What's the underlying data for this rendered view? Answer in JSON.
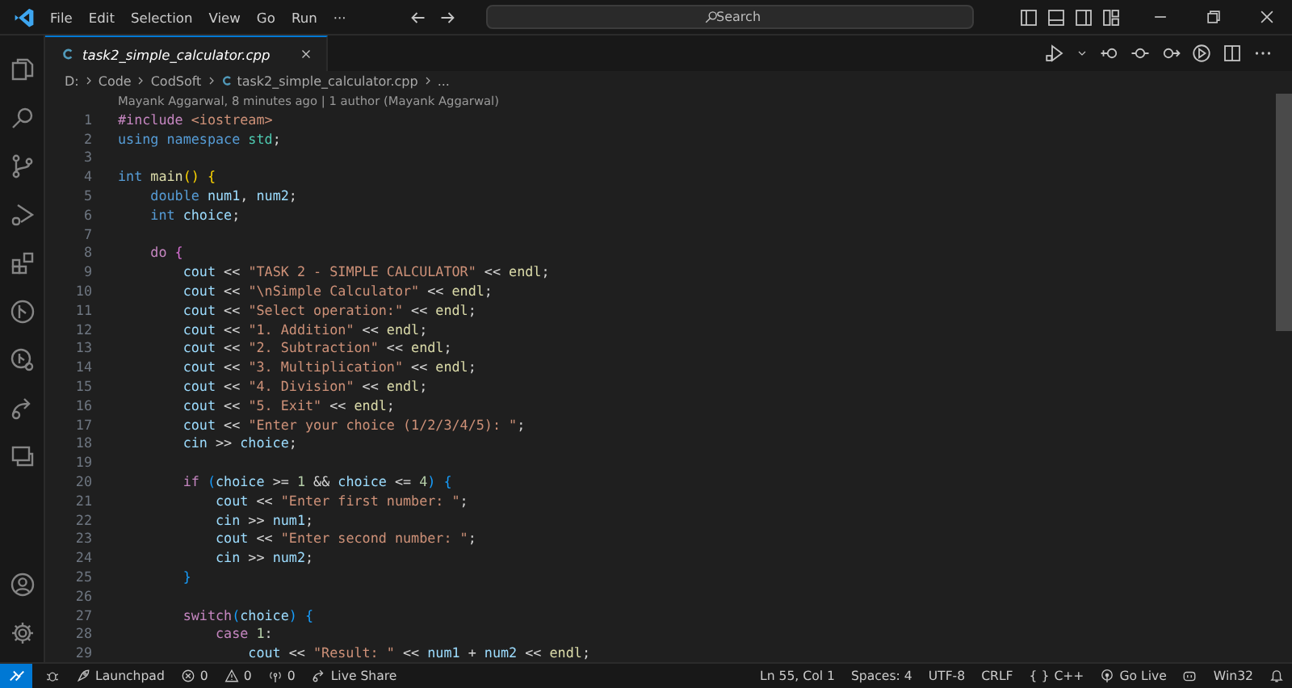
{
  "title_bar": {
    "menus": [
      "File",
      "Edit",
      "Selection",
      "View",
      "Go",
      "Run",
      "···"
    ],
    "search": {
      "placeholder": "Search"
    }
  },
  "tabs": [
    {
      "label": "task2_simple_calculator.cpp",
      "selected": true,
      "italic": true
    }
  ],
  "breadcrumb": [
    "D:",
    "Code",
    "CodSoft",
    "task2_simple_calculator.cpp",
    "..."
  ],
  "codelens": "Mayank Aggarwal, 8 minutes ago | 1 author (Mayank Aggarwal)",
  "code_lines": [
    {
      "number": "1",
      "tokens": [
        {
          "kind": "control",
          "text": "#include"
        },
        {
          "kind": "string",
          "text": " <iostream>"
        }
      ]
    },
    {
      "number": "2",
      "tokens": [
        {
          "kind": "keyword",
          "text": "using"
        },
        {
          "kind": "keyword",
          "text": " namespace"
        },
        {
          "kind": "type",
          "text": " std"
        },
        {
          "kind": "plain",
          "text": ";"
        }
      ]
    },
    {
      "number": "3"
    },
    {
      "number": "4",
      "tokens": [
        {
          "kind": "keyword",
          "text": "int"
        },
        {
          "kind": "function",
          "text": " main"
        },
        {
          "kind": "bracket1",
          "text": "()"
        },
        {
          "kind": "bracket1",
          "text": " {"
        }
      ]
    },
    {
      "number": "5",
      "tokens": [
        {
          "kind": "keyword",
          "text": "    double"
        },
        {
          "kind": "variable",
          "text": " num1"
        },
        {
          "kind": "plain",
          "text": ","
        },
        {
          "kind": "variable",
          "text": " num2"
        },
        {
          "kind": "plain",
          "text": ";"
        }
      ]
    },
    {
      "number": "6",
      "tokens": [
        {
          "kind": "keyword",
          "text": "    int"
        },
        {
          "kind": "variable",
          "text": " choice"
        },
        {
          "kind": "plain",
          "text": ";"
        }
      ]
    },
    {
      "number": "7"
    },
    {
      "number": "8",
      "tokens": [
        {
          "kind": "control",
          "text": "    do"
        },
        {
          "kind": "bracket2",
          "text": " {"
        }
      ]
    },
    {
      "number": "9",
      "tokens": [
        {
          "kind": "variable",
          "text": "        cout"
        },
        {
          "kind": "plain",
          "text": " << "
        },
        {
          "kind": "string",
          "text": "\"TASK 2 - SIMPLE CALCULATOR\""
        },
        {
          "kind": "plain",
          "text": " << "
        },
        {
          "kind": "function",
          "text": "endl"
        },
        {
          "kind": "plain",
          "text": ";"
        }
      ]
    },
    {
      "number": "10",
      "tokens": [
        {
          "kind": "variable",
          "text": "        cout"
        },
        {
          "kind": "plain",
          "text": " << "
        },
        {
          "kind": "string",
          "text": "\"\\nSimple Calculator\""
        },
        {
          "kind": "plain",
          "text": " << "
        },
        {
          "kind": "function",
          "text": "endl"
        },
        {
          "kind": "plain",
          "text": ";"
        }
      ]
    },
    {
      "number": "11",
      "tokens": [
        {
          "kind": "variable",
          "text": "        cout"
        },
        {
          "kind": "plain",
          "text": " << "
        },
        {
          "kind": "string",
          "text": "\"Select operation:\""
        },
        {
          "kind": "plain",
          "text": " << "
        },
        {
          "kind": "function",
          "text": "endl"
        },
        {
          "kind": "plain",
          "text": ";"
        }
      ]
    },
    {
      "number": "12",
      "tokens": [
        {
          "kind": "variable",
          "text": "        cout"
        },
        {
          "kind": "plain",
          "text": " << "
        },
        {
          "kind": "string",
          "text": "\"1. Addition\""
        },
        {
          "kind": "plain",
          "text": " << "
        },
        {
          "kind": "function",
          "text": "endl"
        },
        {
          "kind": "plain",
          "text": ";"
        }
      ]
    },
    {
      "number": "13",
      "tokens": [
        {
          "kind": "variable",
          "text": "        cout"
        },
        {
          "kind": "plain",
          "text": " << "
        },
        {
          "kind": "string",
          "text": "\"2. Subtraction\""
        },
        {
          "kind": "plain",
          "text": " << "
        },
        {
          "kind": "function",
          "text": "endl"
        },
        {
          "kind": "plain",
          "text": ";"
        }
      ]
    },
    {
      "number": "14",
      "tokens": [
        {
          "kind": "variable",
          "text": "        cout"
        },
        {
          "kind": "plain",
          "text": " << "
        },
        {
          "kind": "string",
          "text": "\"3. Multiplication\""
        },
        {
          "kind": "plain",
          "text": " << "
        },
        {
          "kind": "function",
          "text": "endl"
        },
        {
          "kind": "plain",
          "text": ";"
        }
      ]
    },
    {
      "number": "15",
      "tokens": [
        {
          "kind": "variable",
          "text": "        cout"
        },
        {
          "kind": "plain",
          "text": " << "
        },
        {
          "kind": "string",
          "text": "\"4. Division\""
        },
        {
          "kind": "plain",
          "text": " << "
        },
        {
          "kind": "function",
          "text": "endl"
        },
        {
          "kind": "plain",
          "text": ";"
        }
      ]
    },
    {
      "number": "16",
      "tokens": [
        {
          "kind": "variable",
          "text": "        cout"
        },
        {
          "kind": "plain",
          "text": " << "
        },
        {
          "kind": "string",
          "text": "\"5. Exit\""
        },
        {
          "kind": "plain",
          "text": " << "
        },
        {
          "kind": "function",
          "text": "endl"
        },
        {
          "kind": "plain",
          "text": ";"
        }
      ]
    },
    {
      "number": "17",
      "tokens": [
        {
          "kind": "variable",
          "text": "        cout"
        },
        {
          "kind": "plain",
          "text": " << "
        },
        {
          "kind": "string",
          "text": "\"Enter your choice (1/2/3/4/5): \""
        },
        {
          "kind": "plain",
          "text": ";"
        }
      ]
    },
    {
      "number": "18",
      "tokens": [
        {
          "kind": "variable",
          "text": "        cin"
        },
        {
          "kind": "plain",
          "text": " >> "
        },
        {
          "kind": "variable",
          "text": "choice"
        },
        {
          "kind": "plain",
          "text": ";"
        }
      ]
    },
    {
      "number": "19"
    },
    {
      "number": "20",
      "tokens": [
        {
          "kind": "control",
          "text": "        if"
        },
        {
          "kind": "bracket3",
          "text": " ("
        },
        {
          "kind": "variable",
          "text": "choice"
        },
        {
          "kind": "plain",
          "text": " >= "
        },
        {
          "kind": "number",
          "text": "1"
        },
        {
          "kind": "plain",
          "text": " && "
        },
        {
          "kind": "variable",
          "text": "choice"
        },
        {
          "kind": "plain",
          "text": " <= "
        },
        {
          "kind": "number",
          "text": "4"
        },
        {
          "kind": "bracket3",
          "text": ")"
        },
        {
          "kind": "bracket3",
          "text": " {"
        }
      ]
    },
    {
      "number": "21",
      "tokens": [
        {
          "kind": "variable",
          "text": "            cout"
        },
        {
          "kind": "plain",
          "text": " << "
        },
        {
          "kind": "string",
          "text": "\"Enter first number: \""
        },
        {
          "kind": "plain",
          "text": ";"
        }
      ]
    },
    {
      "number": "22",
      "tokens": [
        {
          "kind": "variable",
          "text": "            cin"
        },
        {
          "kind": "plain",
          "text": " >> "
        },
        {
          "kind": "variable",
          "text": "num1"
        },
        {
          "kind": "plain",
          "text": ";"
        }
      ]
    },
    {
      "number": "23",
      "tokens": [
        {
          "kind": "variable",
          "text": "            cout"
        },
        {
          "kind": "plain",
          "text": " << "
        },
        {
          "kind": "string",
          "text": "\"Enter second number: \""
        },
        {
          "kind": "plain",
          "text": ";"
        }
      ]
    },
    {
      "number": "24",
      "tokens": [
        {
          "kind": "variable",
          "text": "            cin"
        },
        {
          "kind": "plain",
          "text": " >> "
        },
        {
          "kind": "variable",
          "text": "num2"
        },
        {
          "kind": "plain",
          "text": ";"
        }
      ]
    },
    {
      "number": "25",
      "tokens": [
        {
          "kind": "bracket3",
          "text": "        }"
        }
      ]
    },
    {
      "number": "26"
    },
    {
      "number": "27",
      "tokens": [
        {
          "kind": "control",
          "text": "        switch"
        },
        {
          "kind": "bracket3",
          "text": "("
        },
        {
          "kind": "variable",
          "text": "choice"
        },
        {
          "kind": "bracket3",
          "text": ")"
        },
        {
          "kind": "bracket3",
          "text": " {"
        }
      ]
    },
    {
      "number": "28",
      "tokens": [
        {
          "kind": "control",
          "text": "            case"
        },
        {
          "kind": "number",
          "text": " 1"
        },
        {
          "kind": "plain",
          "text": ":"
        }
      ]
    },
    {
      "number": "29",
      "tokens": [
        {
          "kind": "variable",
          "text": "                cout"
        },
        {
          "kind": "plain",
          "text": " << "
        },
        {
          "kind": "string",
          "text": "\"Result: \""
        },
        {
          "kind": "plain",
          "text": " << "
        },
        {
          "kind": "variable",
          "text": "num1"
        },
        {
          "kind": "plain",
          "text": " + "
        },
        {
          "kind": "variable",
          "text": "num2"
        },
        {
          "kind": "plain",
          "text": " << "
        },
        {
          "kind": "function",
          "text": "endl"
        },
        {
          "kind": "plain",
          "text": ";"
        }
      ]
    }
  ],
  "status_bar": {
    "left": [
      {
        "kind": "remote"
      },
      {
        "kind": "extension"
      },
      {
        "kind": "launchpad",
        "text": "Launchpad"
      },
      {
        "kind": "errors",
        "text": "0"
      },
      {
        "kind": "warnings",
        "text": "0"
      },
      {
        "kind": "ports",
        "text": "0"
      },
      {
        "kind": "liveshare",
        "text": "Live Share"
      }
    ],
    "right": [
      {
        "kind": "plain",
        "text": "Ln 55, Col 1"
      },
      {
        "kind": "plain",
        "text": "Spaces: 4"
      },
      {
        "kind": "plain",
        "text": "UTF-8"
      },
      {
        "kind": "plain",
        "text": "CRLF"
      },
      {
        "kind": "language",
        "glyph": "{ }",
        "text": "C++"
      },
      {
        "kind": "golive",
        "text": "Go Live"
      },
      {
        "kind": "robot"
      },
      {
        "kind": "plain",
        "text": "Win32"
      },
      {
        "kind": "bell"
      }
    ]
  }
}
